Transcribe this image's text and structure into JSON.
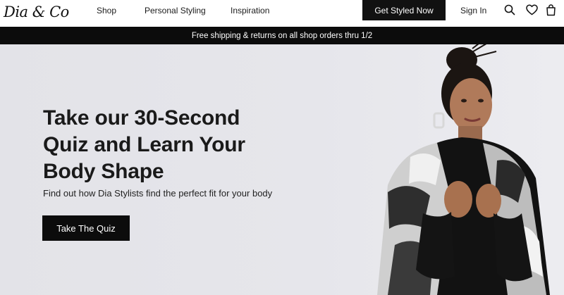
{
  "header": {
    "logo": "Dia & Co",
    "nav": [
      "Shop",
      "Personal Styling",
      "Inspiration"
    ],
    "cta_label": "Get Styled Now",
    "signin_label": "Sign In",
    "icons": [
      "search-icon",
      "heart-icon",
      "shopping-bag-icon"
    ]
  },
  "promo": {
    "text": "Free shipping & returns on all shop orders thru 1/2"
  },
  "hero": {
    "title_lines": [
      "Take our 30-Second",
      "Quiz and Learn Your",
      "Body Shape"
    ],
    "subtitle": "Find out how Dia Stylists find the perfect fit for your body",
    "button_label": "Take The Quiz",
    "image_description": "model in black turtleneck and patchwork faux fur vest"
  },
  "colors": {
    "accent": "#111111",
    "hero_bg": "#e5e5ea",
    "promo_bg": "#0c0c0c"
  }
}
